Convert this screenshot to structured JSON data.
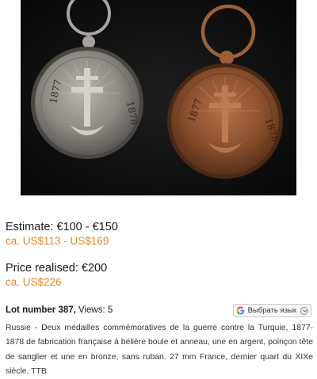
{
  "estimate": {
    "eur": "Estimate: €100 - €150",
    "usd": "ca. US$113 - US$169"
  },
  "price_realised": {
    "eur": "Price realised:  €200",
    "usd": "ca. US$226"
  },
  "lot": {
    "number_label": "Lot number 387,",
    "views": " Views: 5"
  },
  "translate_button": {
    "label": "Выбрать язык",
    "icon": "google-g-icon"
  },
  "description": "Russie - Deux médailles commémoratives de la guerre contre la Turquie, 1877-1878 de fabrication française à bélière boule et anneau, une en argent, poinçon tête de sanglier et une en bronze, sans ruban. 27 mm France, dernier quart du XIXe siècle. TTB",
  "photo": {
    "medal_silver_left_text": "1877",
    "medal_silver_right_text": "1878",
    "medal_bronze_left_text": "1877",
    "medal_bronze_right_text": "1878",
    "colors": {
      "background": "#111111",
      "silver": "#9a9690",
      "bronze": "#8a4f2c"
    }
  },
  "colors": {
    "usd_text": "#e0892c",
    "body_text": "#333333"
  }
}
